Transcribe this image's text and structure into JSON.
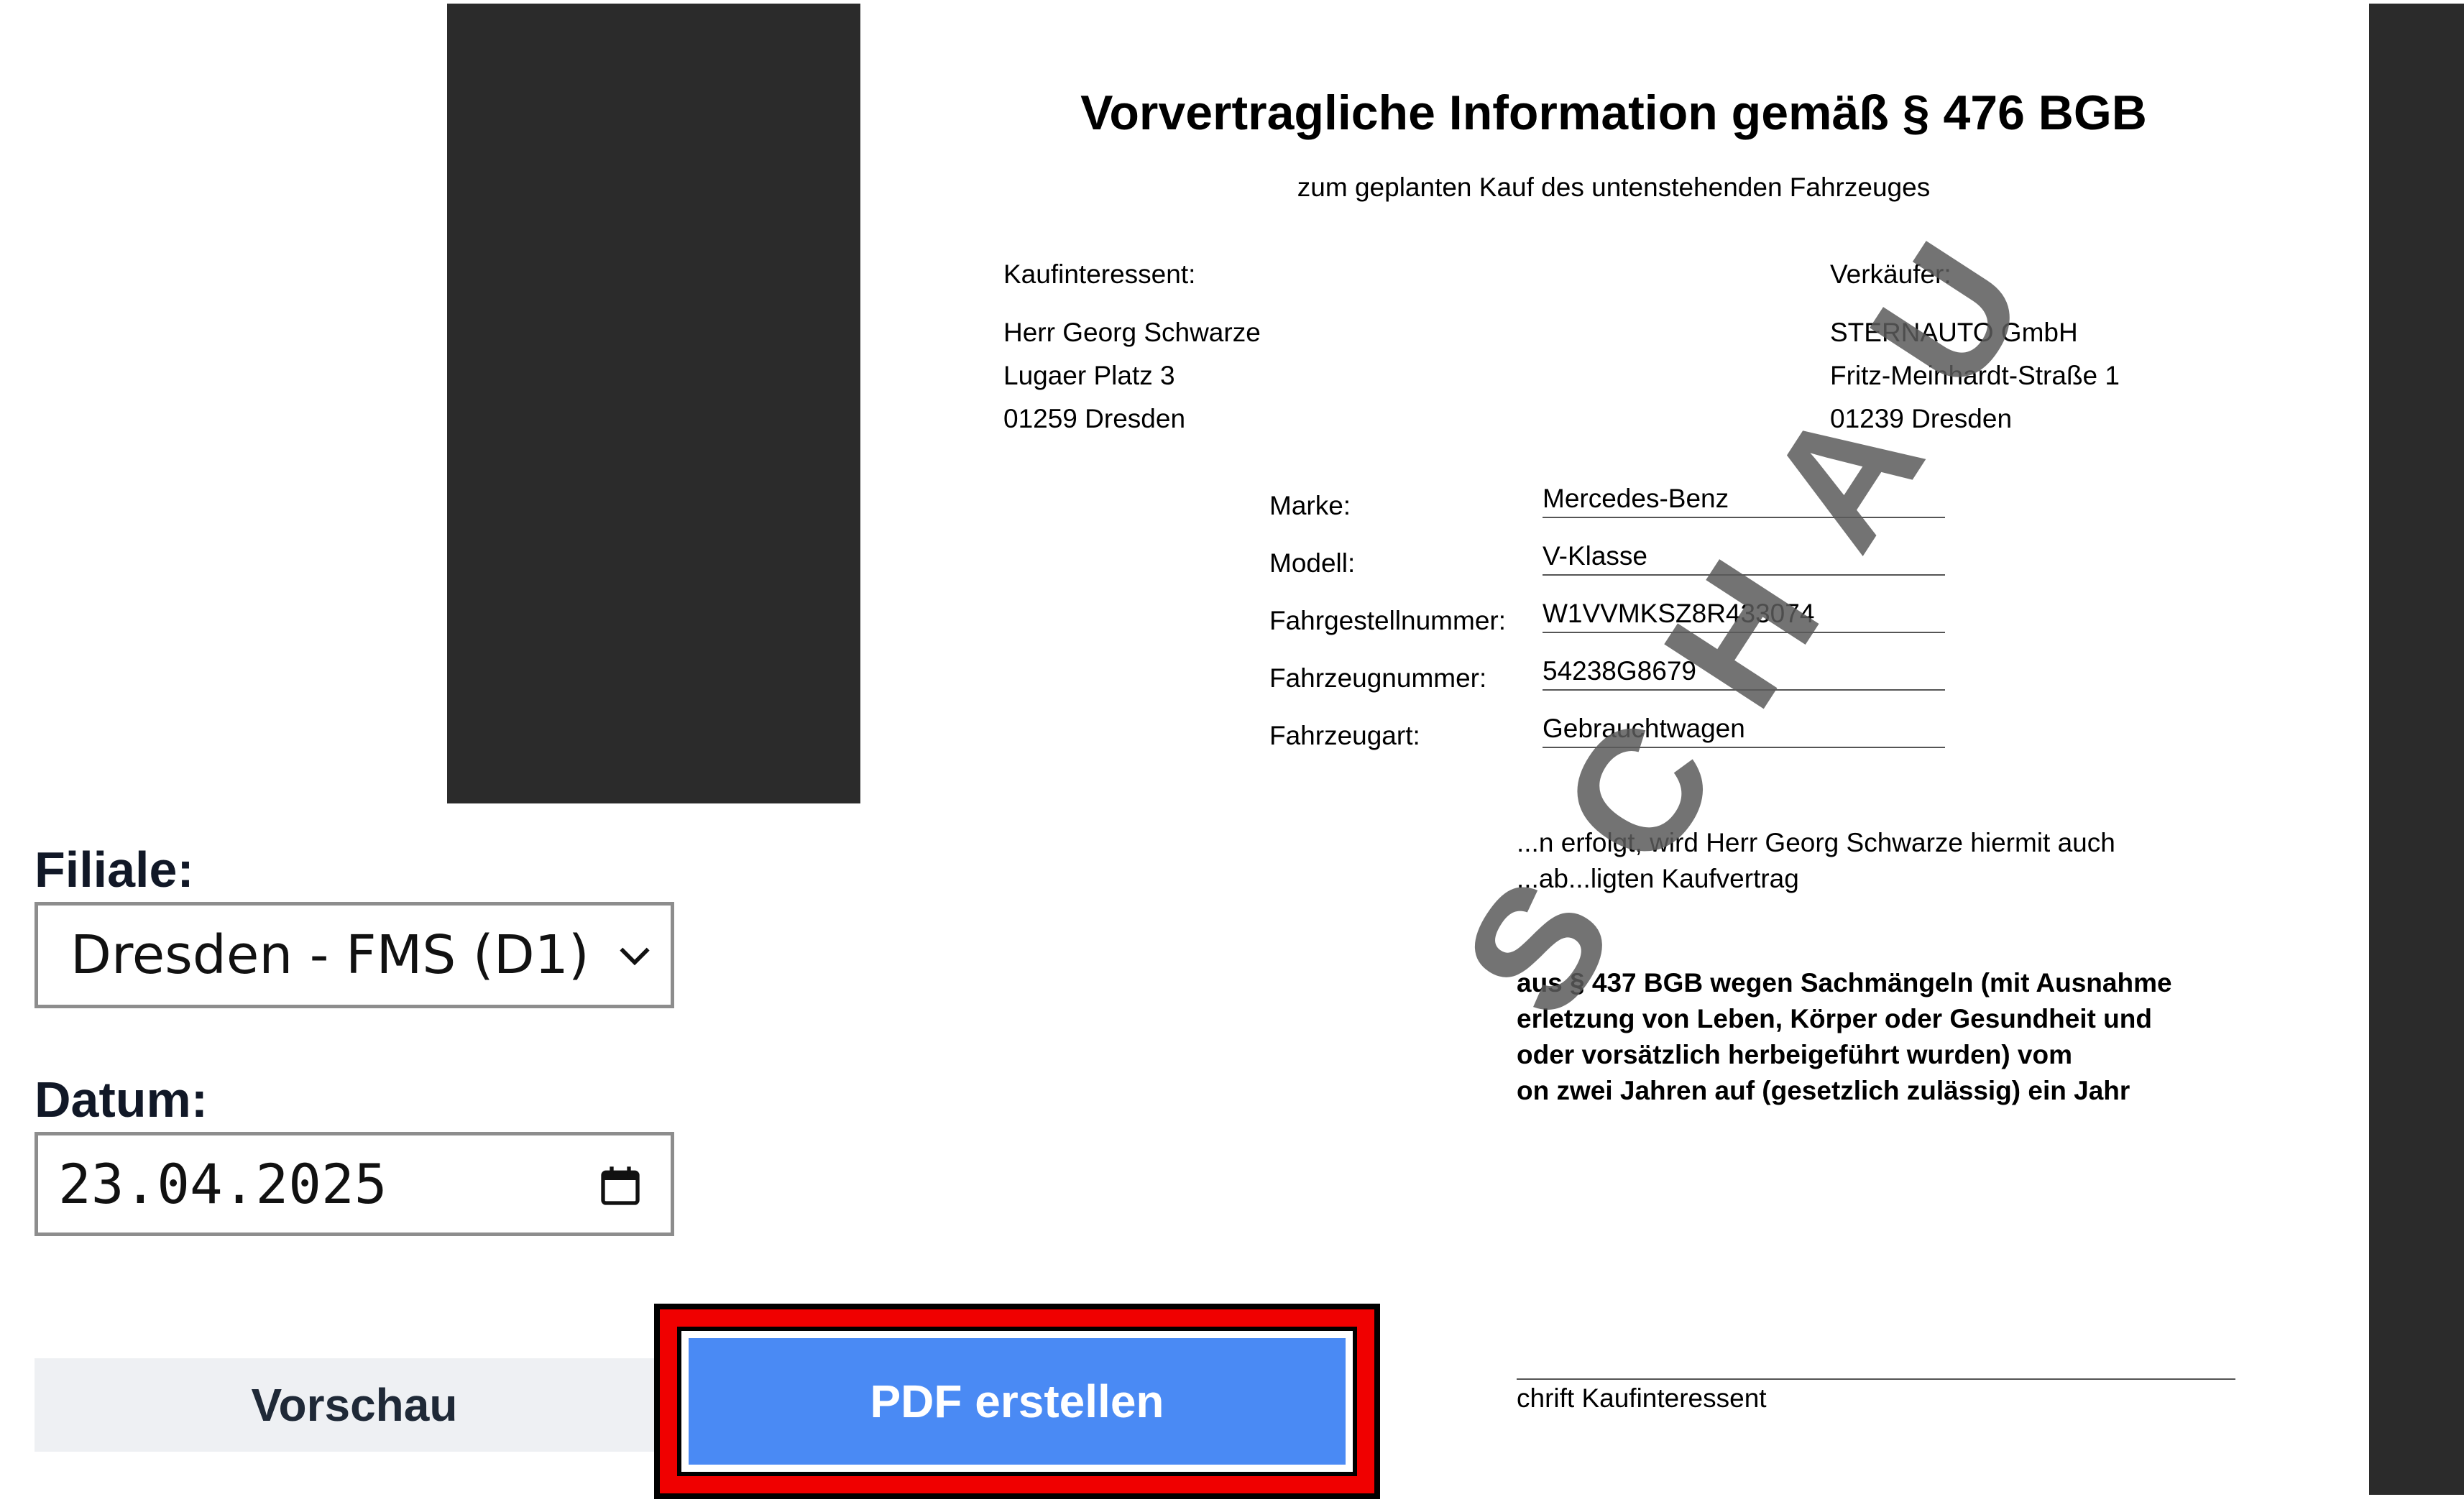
{
  "document": {
    "title": "Vorvertragliche Information gemäß § 476 BGB",
    "subtitle": "zum geplanten Kauf des untenstehenden Fahrzeuges",
    "buyer": {
      "heading": "Kaufinteressent:",
      "name": "Herr Georg Schwarze",
      "street": "Lugaer Platz 3",
      "city": "01259 Dresden"
    },
    "seller": {
      "heading": "Verkäufer:",
      "name": "STERNAUTO GmbH",
      "street": "Fritz-Meinhardt-Straße 1",
      "city": "01239 Dresden"
    },
    "vehicle": {
      "brand_label": "Marke:",
      "brand_value": "Mercedes-Benz",
      "model_label": "Modell:",
      "model_value": "V-Klasse",
      "vin_label": "Fahrgestellnummer:",
      "vin_value": "W1VVMKSZ8R433074",
      "vehicle_no_label": "Fahrzeugnummer:",
      "vehicle_no_value": "54238G8679",
      "type_label": "Fahrzeugart:",
      "type_value": "Gebrauchtwagen"
    },
    "paragraph1": [
      "...n erfolgt, wird Herr Georg Schwarze hiermit auch",
      "...ab...ligten Kaufvertrag"
    ],
    "paragraph2": [
      "aus § 437 BGB wegen Sachmängeln (mit Ausnahme",
      "erletzung von Leben, Körper oder Gesundheit und",
      "oder vorsätzlich herbeigeführt wurden) vom",
      "on zwei Jahren auf (gesetzlich zulässig) ein Jahr"
    ],
    "signature_label": "chrift Kaufinteressent",
    "watermark": "SCHAU"
  },
  "form": {
    "branch_label": "Filiale:",
    "branch_value": "Dresden - FMS (D1)",
    "date_label": "Datum:",
    "date_value": "23.04.2025"
  },
  "buttons": {
    "preview_label": "Vorschau",
    "pdf_label": "PDF erstellen"
  },
  "colors": {
    "pdf_button": "#4a8af4",
    "highlight": "#f00000",
    "preview_button": "#eef0f3"
  }
}
